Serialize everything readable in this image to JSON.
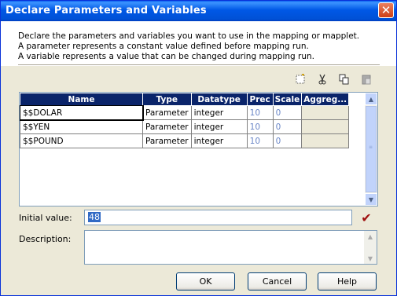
{
  "window": {
    "title": "Declare Parameters and Variables"
  },
  "instructions": [
    "Declare the parameters and variables you want to use in the mapping or mapplet.",
    "A parameter represents a constant value defined before mapping run.",
    "A variable represents a value that can be changed during mapping run."
  ],
  "toolbar": {
    "icons": [
      "new-icon",
      "cut-icon",
      "copy-icon",
      "paste-icon"
    ]
  },
  "grid": {
    "columns": [
      "Name",
      "Type",
      "Datatype",
      "Prec",
      "Scale",
      "Aggreg..."
    ],
    "rows": [
      {
        "name": "$$DOLAR",
        "type": "Parameter",
        "datatype": "integer",
        "prec": "10",
        "scale": "0",
        "aggregation": ""
      },
      {
        "name": "$$YEN",
        "type": "Parameter",
        "datatype": "integer",
        "prec": "10",
        "scale": "0",
        "aggregation": ""
      },
      {
        "name": "$$POUND",
        "type": "Parameter",
        "datatype": "integer",
        "prec": "10",
        "scale": "0",
        "aggregation": ""
      }
    ]
  },
  "initial_value": {
    "label": "Initial value:",
    "value": "48"
  },
  "description": {
    "label": "Description:",
    "value": ""
  },
  "buttons": {
    "ok": "OK",
    "cancel": "Cancel",
    "help": "Help"
  },
  "colors": {
    "titlebar": "#0058e6",
    "grid_header": "#0a246a",
    "check": "#a01010"
  }
}
